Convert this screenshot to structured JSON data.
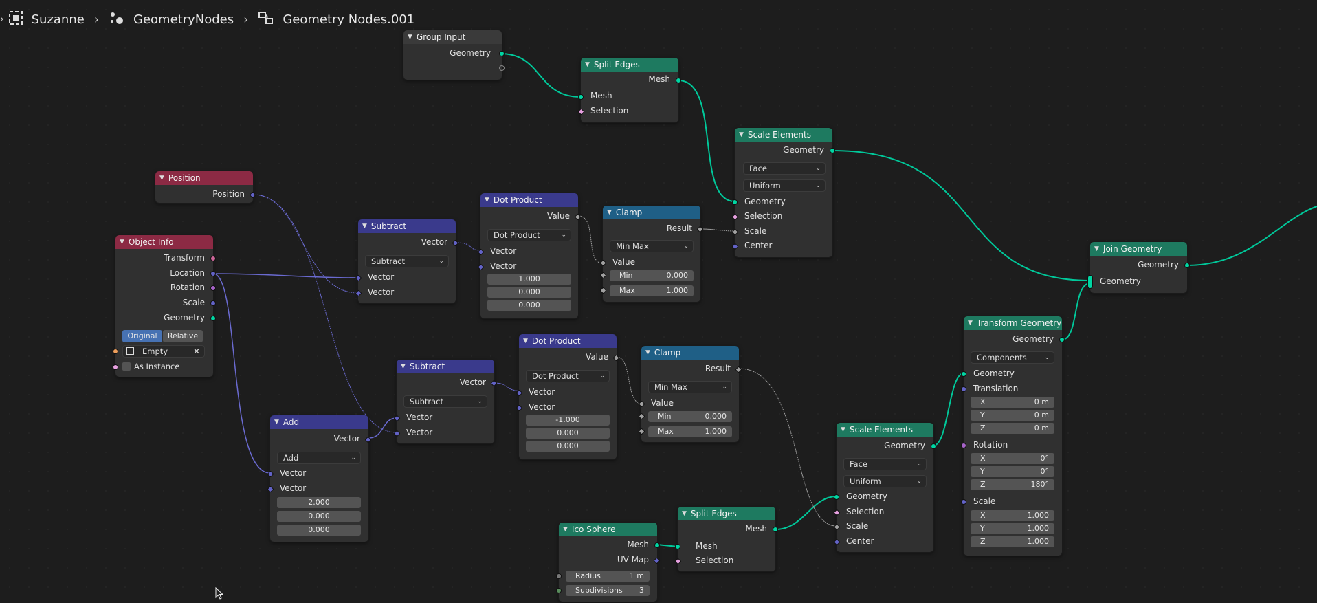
{
  "breadcrumb": {
    "object": "Suzanne",
    "modifier": "GeometryNodes",
    "tree": "Geometry Nodes.001"
  },
  "colors": {
    "geometry_header": "#1e7a60",
    "vector_header": "#3a3a8c",
    "input_header": "#8c2a44",
    "converter_header": "#1f5f86",
    "geometry_socket": "#00d6a3",
    "vector_socket": "#6363c7"
  },
  "nodes": {
    "group_input": {
      "title": "Group Input",
      "out_geometry": "Geometry"
    },
    "split_edges_1": {
      "title": "Split Edges",
      "out_mesh": "Mesh",
      "in_mesh": "Mesh",
      "in_selection": "Selection"
    },
    "scale_elements_1": {
      "title": "Scale Elements",
      "out_geometry": "Geometry",
      "domain": "Face",
      "mode": "Uniform",
      "in_geometry": "Geometry",
      "in_selection": "Selection",
      "in_scale": "Scale",
      "in_center": "Center"
    },
    "position": {
      "title": "Position",
      "out_position": "Position"
    },
    "object_info": {
      "title": "Object Info",
      "out_transform": "Transform",
      "out_location": "Location",
      "out_rotation": "Rotation",
      "out_scale": "Scale",
      "out_geometry": "Geometry",
      "btn_original": "Original",
      "btn_relative": "Relative",
      "object": "Empty",
      "as_instance": "As Instance"
    },
    "subtract_1": {
      "title": "Subtract",
      "out_vector": "Vector",
      "op": "Subtract",
      "in_a": "Vector",
      "in_b": "Vector"
    },
    "dot_1": {
      "title": "Dot Product",
      "out_value": "Value",
      "op": "Dot Product",
      "in_a": "Vector",
      "in_b": "Vector",
      "vx": "1.000",
      "vy": "0.000",
      "vz": "0.000"
    },
    "clamp_1": {
      "title": "Clamp",
      "out_result": "Result",
      "mode": "Min Max",
      "in_value": "Value",
      "min_label": "Min",
      "min": "0.000",
      "max_label": "Max",
      "max": "1.000"
    },
    "join_geometry": {
      "title": "Join Geometry",
      "out_geometry": "Geometry",
      "in_geometry": "Geometry"
    },
    "subtract_2": {
      "title": "Subtract",
      "out_vector": "Vector",
      "op": "Subtract",
      "in_a": "Vector",
      "in_b": "Vector"
    },
    "dot_2": {
      "title": "Dot Product",
      "out_value": "Value",
      "op": "Dot Product",
      "in_a": "Vector",
      "in_b": "Vector",
      "vx": "-1.000",
      "vy": "0.000",
      "vz": "0.000"
    },
    "clamp_2": {
      "title": "Clamp",
      "out_result": "Result",
      "mode": "Min Max",
      "in_value": "Value",
      "min_label": "Min",
      "min": "0.000",
      "max_label": "Max",
      "max": "1.000"
    },
    "transform_geometry": {
      "title": "Transform Geometry",
      "out_geometry": "Geometry",
      "mode": "Components",
      "in_geometry": "Geometry",
      "translation": "Translation",
      "tx": "0 m",
      "ty": "0 m",
      "tz": "0 m",
      "rotation": "Rotation",
      "rx": "0°",
      "ry": "0°",
      "rz": "180°",
      "scale": "Scale",
      "sx": "1.000",
      "sy": "1.000",
      "sz": "1.000",
      "x": "X",
      "y": "Y",
      "z": "Z"
    },
    "add": {
      "title": "Add",
      "out_vector": "Vector",
      "op": "Add",
      "in_a": "Vector",
      "in_b": "Vector",
      "vx": "2.000",
      "vy": "0.000",
      "vz": "0.000"
    },
    "scale_elements_2": {
      "title": "Scale Elements",
      "out_geometry": "Geometry",
      "domain": "Face",
      "mode": "Uniform",
      "in_geometry": "Geometry",
      "in_selection": "Selection",
      "in_scale": "Scale",
      "in_center": "Center"
    },
    "split_edges_2": {
      "title": "Split Edges",
      "out_mesh": "Mesh",
      "in_mesh": "Mesh",
      "in_selection": "Selection"
    },
    "ico_sphere": {
      "title": "Ico Sphere",
      "out_mesh": "Mesh",
      "out_uvmap": "UV Map",
      "radius_label": "Radius",
      "radius": "1 m",
      "subdiv_label": "Subdivisions",
      "subdiv": "3"
    }
  }
}
